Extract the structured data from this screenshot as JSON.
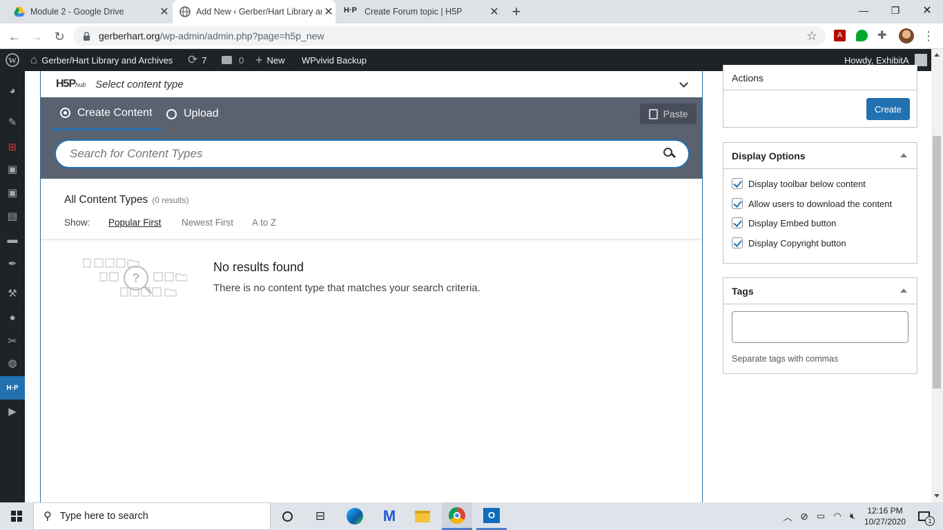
{
  "browser": {
    "tabs": [
      {
        "title": "Module 2 - Google Drive",
        "icon": "google-drive-icon"
      },
      {
        "title": "Add New ‹ Gerber/Hart Library an",
        "icon": "globe-icon"
      },
      {
        "title": "Create Forum topic | H5P",
        "icon": "h5p-icon"
      }
    ],
    "new_tab": "+",
    "url_domain": "gerberhart.org",
    "url_path": "/wp-admin/admin.php?page=h5p_new"
  },
  "adminbar": {
    "site_name": "Gerber/Hart Library and Archives",
    "updates_count": "7",
    "comments_count": "0",
    "new_label": "New",
    "plugin_label": "WPvivid Backup",
    "howdy": "Howdy, ExhibitA"
  },
  "hub": {
    "logo": "H5P",
    "logo_sub": "hub",
    "select_label": "Select content type",
    "tab_create": "Create Content",
    "tab_upload": "Upload",
    "paste_label": "Paste",
    "search_placeholder": "Search for Content Types",
    "list_title": "All Content Types",
    "results": "(0 results)",
    "show_label": "Show:",
    "sort_options": [
      "Popular First",
      "Newest First",
      "A to Z"
    ],
    "empty_title": "No results found",
    "empty_text": "There is no content type that matches your search criteria."
  },
  "sidebar": {
    "actions_title": "Actions",
    "create_label": "Create",
    "display_title": "Display Options",
    "display_options": [
      {
        "label": "Display toolbar below content",
        "checked": true
      },
      {
        "label": "Allow users to download the content",
        "checked": true
      },
      {
        "label": "Display Embed button",
        "checked": true
      },
      {
        "label": "Display Copyright button",
        "checked": true
      }
    ],
    "tags_title": "Tags",
    "tags_hint": "Separate tags with commas"
  },
  "taskbar": {
    "search_placeholder": "Type here to search",
    "time": "12:16 PM",
    "date": "10/27/2020",
    "notif_count": "1"
  },
  "colors": {
    "wp_dark": "#1d2327",
    "wp_blue": "#2271b1",
    "hub_bar": "#5a6270"
  }
}
